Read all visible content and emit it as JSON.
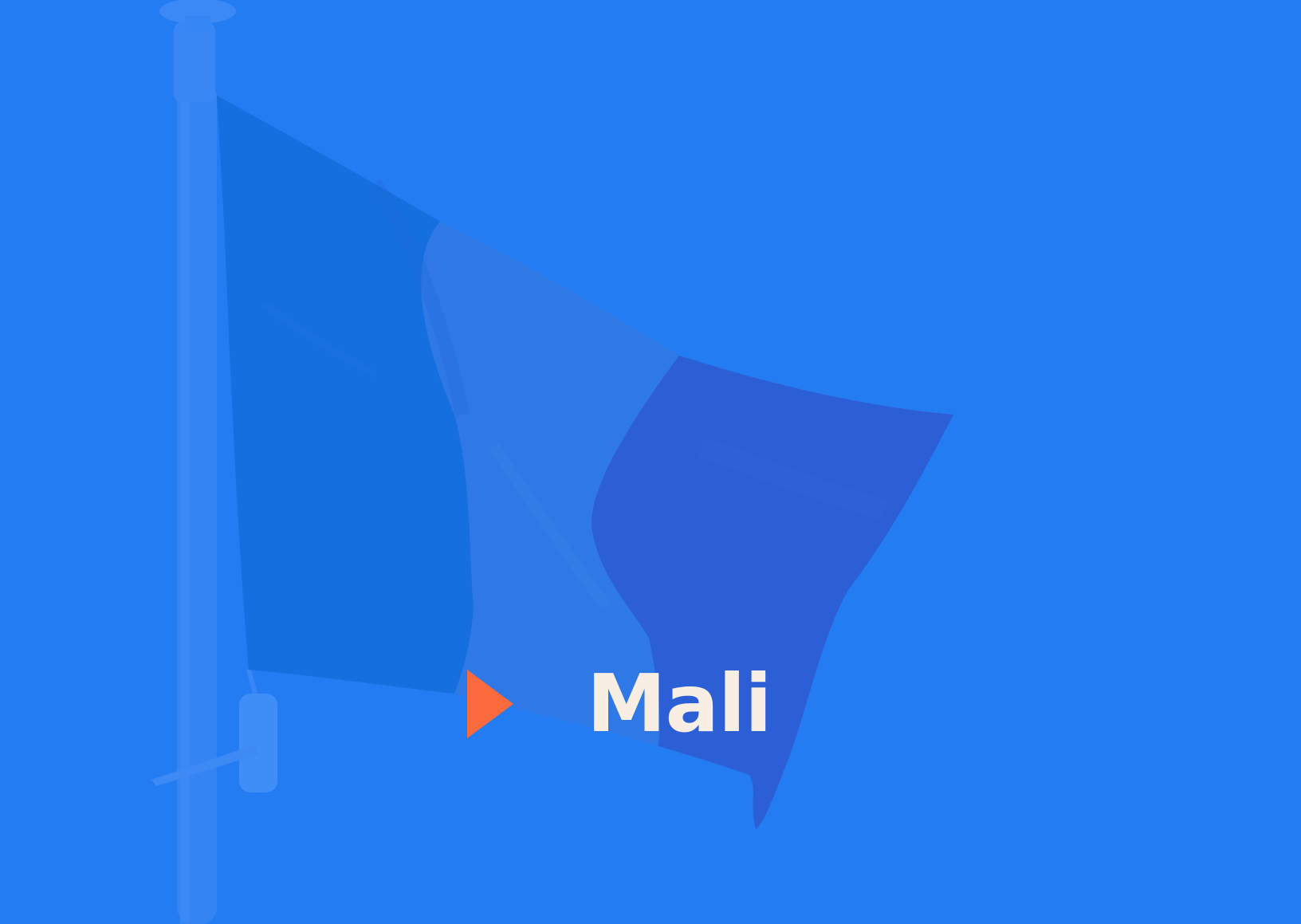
{
  "title": {
    "text": "Mali",
    "color": "#f9eee3"
  },
  "icon": {
    "name": "play-triangle-icon",
    "color": "#fb6a3d"
  },
  "colors": {
    "background": "#247cf3",
    "pole": "#3a86f4",
    "flag_left": "#156fde",
    "flag_middle": "#2f79e6",
    "flag_right": "#2c5fd6"
  }
}
